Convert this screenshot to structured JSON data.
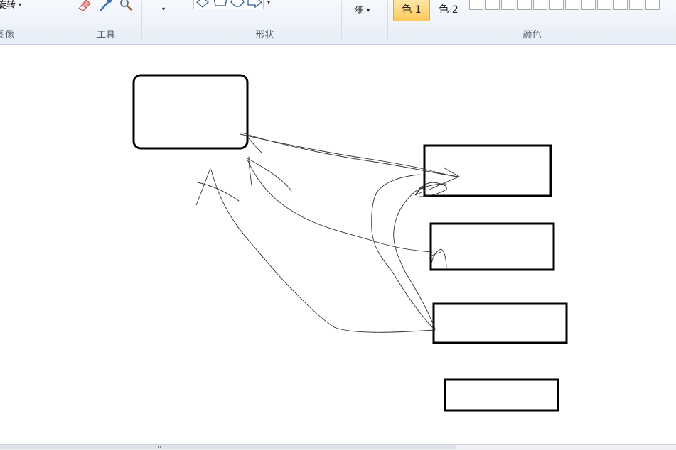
{
  "ribbon": {
    "rotate_label": "旋转",
    "group_image_label": "图像",
    "group_tools_label": "工具",
    "group_shapes_label": "形状",
    "size_label": "细",
    "group_colors_label": "颜色",
    "color1_label": "色 1",
    "color2_label": "色 2",
    "tool_icons": [
      "eraser-icon",
      "color-picker-icon",
      "magnifier-icon"
    ],
    "shape_icons": [
      "diamond-shape-icon",
      "pentagon-shape-icon",
      "hexagon-shape-icon",
      "right-arrow-shape-icon"
    ],
    "palette_swatches": 12,
    "accent_color": "#fcc95b"
  },
  "canvas": {
    "background": "#ffffff",
    "stroke_color": "#000000"
  }
}
